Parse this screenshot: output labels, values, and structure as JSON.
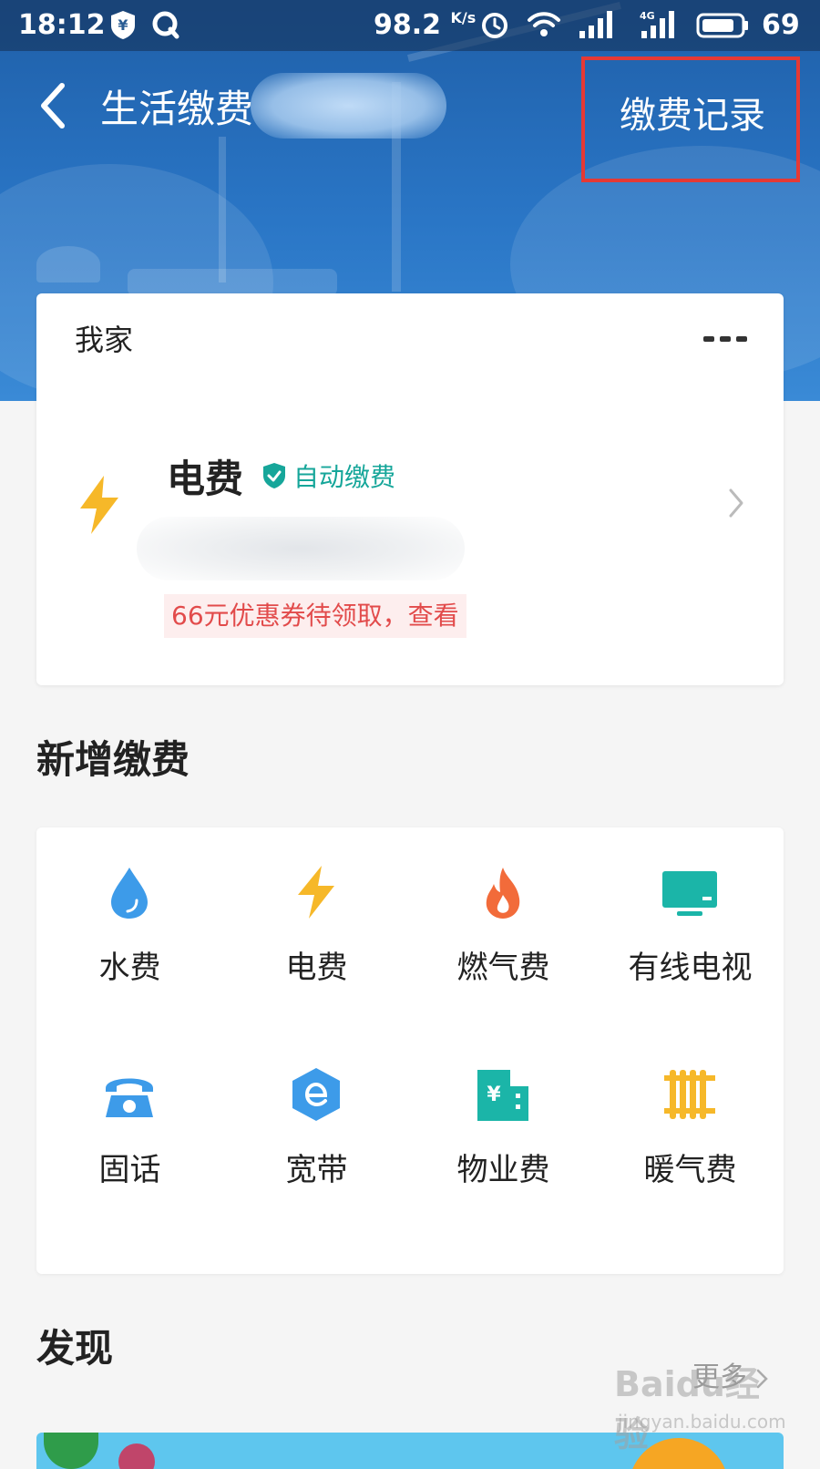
{
  "status_bar": {
    "time": "18:12",
    "speed_value": "98.2",
    "speed_unit": "K/s",
    "network": "4G",
    "battery": "69"
  },
  "nav": {
    "title": "生活缴费",
    "record_label": "缴费记录"
  },
  "home_card": {
    "title": "我家",
    "bill": {
      "name": "电费",
      "autopay_label": "自动缴费",
      "coupon_text": "66元优惠券待领取，查看"
    }
  },
  "add_payment": {
    "title": "新增缴费",
    "items": [
      {
        "label": "水费",
        "icon": "water-drop-icon",
        "color": "#3d9be9"
      },
      {
        "label": "电费",
        "icon": "lightning-icon",
        "color": "#f6b829"
      },
      {
        "label": "燃气费",
        "icon": "flame-icon",
        "color": "#f26b3a"
      },
      {
        "label": "有线电视",
        "icon": "tv-icon",
        "color": "#1bb5a8"
      },
      {
        "label": "固话",
        "icon": "telephone-icon",
        "color": "#3d9be9"
      },
      {
        "label": "宽带",
        "icon": "broadband-icon",
        "color": "#3d9be9"
      },
      {
        "label": "物业费",
        "icon": "building-icon",
        "color": "#1bb5a8"
      },
      {
        "label": "暖气费",
        "icon": "radiator-icon",
        "color": "#f6b829"
      }
    ]
  },
  "discover": {
    "title": "发现",
    "more_label": "更多"
  },
  "watermark": {
    "brand": "Baidu经验",
    "url": "jingyan.baidu.com"
  },
  "colors": {
    "header_blue": "#2a76c6",
    "highlight_red": "#e53935",
    "teal": "#16a69a",
    "coupon_red": "#e24b4b"
  }
}
